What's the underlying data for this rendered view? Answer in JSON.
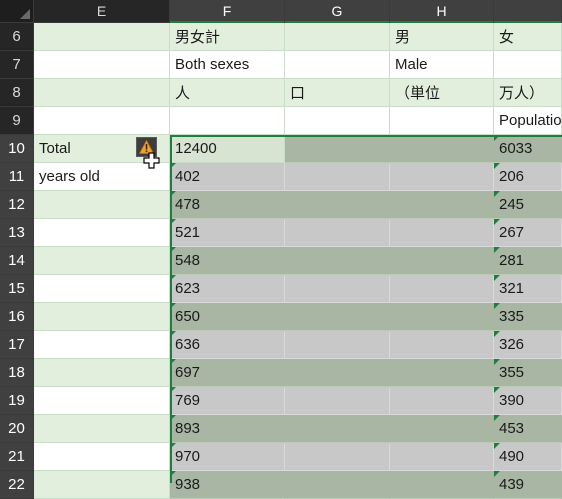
{
  "columns": [
    "E",
    "F",
    "G",
    "H"
  ],
  "partial_column": "",
  "rows": [
    "6",
    "7",
    "8",
    "9",
    "10",
    "11",
    "12",
    "13",
    "14",
    "15",
    "16",
    "17",
    "18",
    "19",
    "20",
    "21",
    "22"
  ],
  "cells": {
    "F6": "男女計",
    "H6": "男",
    "I6": "女",
    "F7": "Both sexes",
    "H7": "Male",
    "F8": "人",
    "G8": "口",
    "H8": "（単位",
    "I8": "万人）",
    "I9": "Population",
    "E10": "Total",
    "E11": "years old"
  },
  "colF": [
    "12400",
    "402",
    "478",
    "521",
    "548",
    "623",
    "650",
    "636",
    "697",
    "769",
    "893",
    "970",
    "938"
  ],
  "colI": [
    "6033",
    "206",
    "245",
    "267",
    "281",
    "321",
    "335",
    "326",
    "355",
    "390",
    "453",
    "490",
    "439"
  ],
  "icons": {
    "warning": "warning-icon",
    "cursor": "cell-cursor-icon"
  }
}
